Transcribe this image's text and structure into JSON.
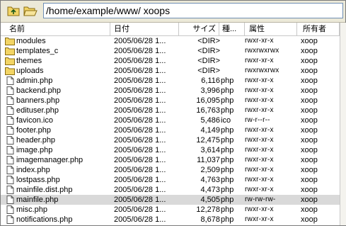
{
  "toolbar": {
    "up_icon": "folder-up-icon",
    "open_icon": "folder-open-icon",
    "path": "/home/example/www/ xoops"
  },
  "columns": {
    "name": "名前",
    "date": "日付",
    "size": "サイズ",
    "type": "種...",
    "attr": "属性",
    "owner": "所有者"
  },
  "rows": [
    {
      "icon": "folder",
      "name": "modules",
      "date": "2005/06/28 1...",
      "size": "<DIR>",
      "type": "",
      "attr": "rwxr-xr-x",
      "owner": "xoop"
    },
    {
      "icon": "folder",
      "name": "templates_c",
      "date": "2005/06/28 1...",
      "size": "<DIR>",
      "type": "",
      "attr": "rwxrwxrwx",
      "owner": "xoop"
    },
    {
      "icon": "folder",
      "name": "themes",
      "date": "2005/06/28 1...",
      "size": "<DIR>",
      "type": "",
      "attr": "rwxr-xr-x",
      "owner": "xoop"
    },
    {
      "icon": "folder",
      "name": "uploads",
      "date": "2005/06/28 1...",
      "size": "<DIR>",
      "type": "",
      "attr": "rwxrwxrwx",
      "owner": "xoop"
    },
    {
      "icon": "file",
      "name": "admin.php",
      "date": "2005/06/28 1...",
      "size": "6,116",
      "type": "php",
      "attr": "rwxr-xr-x",
      "owner": "xoop"
    },
    {
      "icon": "file",
      "name": "backend.php",
      "date": "2005/06/28 1...",
      "size": "3,996",
      "type": "php",
      "attr": "rwxr-xr-x",
      "owner": "xoop"
    },
    {
      "icon": "file",
      "name": "banners.php",
      "date": "2005/06/28 1...",
      "size": "16,095",
      "type": "php",
      "attr": "rwxr-xr-x",
      "owner": "xoop"
    },
    {
      "icon": "file",
      "name": "edituser.php",
      "date": "2005/06/28 1...",
      "size": "16,763",
      "type": "php",
      "attr": "rwxr-xr-x",
      "owner": "xoop"
    },
    {
      "icon": "file",
      "name": "favicon.ico",
      "date": "2005/06/28 1...",
      "size": "5,486",
      "type": "ico",
      "attr": "rw-r--r--",
      "owner": "xoop"
    },
    {
      "icon": "file",
      "name": "footer.php",
      "date": "2005/06/28 1...",
      "size": "4,149",
      "type": "php",
      "attr": "rwxr-xr-x",
      "owner": "xoop"
    },
    {
      "icon": "file",
      "name": "header.php",
      "date": "2005/06/28 1...",
      "size": "12,475",
      "type": "php",
      "attr": "rwxr-xr-x",
      "owner": "xoop"
    },
    {
      "icon": "file",
      "name": "image.php",
      "date": "2005/06/28 1...",
      "size": "3,614",
      "type": "php",
      "attr": "rwxr-xr-x",
      "owner": "xoop"
    },
    {
      "icon": "file",
      "name": "imagemanager.php",
      "date": "2005/06/28 1...",
      "size": "11,037",
      "type": "php",
      "attr": "rwxr-xr-x",
      "owner": "xoop"
    },
    {
      "icon": "file",
      "name": "index.php",
      "date": "2005/06/28 1...",
      "size": "2,509",
      "type": "php",
      "attr": "rwxr-xr-x",
      "owner": "xoop"
    },
    {
      "icon": "file",
      "name": "lostpass.php",
      "date": "2005/06/28 1...",
      "size": "4,763",
      "type": "php",
      "attr": "rwxr-xr-x",
      "owner": "xoop"
    },
    {
      "icon": "file",
      "name": "mainfile.dist.php",
      "date": "2005/06/28 1...",
      "size": "4,473",
      "type": "php",
      "attr": "rwxr-xr-x",
      "owner": "xoop"
    },
    {
      "icon": "file",
      "name": "mainfile.php",
      "date": "2005/06/28 1...",
      "size": "4,505",
      "type": "php",
      "attr": "rw-rw-rw-",
      "owner": "xoop",
      "selected": true
    },
    {
      "icon": "file",
      "name": "misc.php",
      "date": "2005/06/28 1...",
      "size": "12,278",
      "type": "php",
      "attr": "rwxr-xr-x",
      "owner": "xoop"
    },
    {
      "icon": "file",
      "name": "notifications.php",
      "date": "2005/06/28 1...",
      "size": "8,678",
      "type": "php",
      "attr": "rwxr-xr-x",
      "owner": "xoop"
    }
  ]
}
